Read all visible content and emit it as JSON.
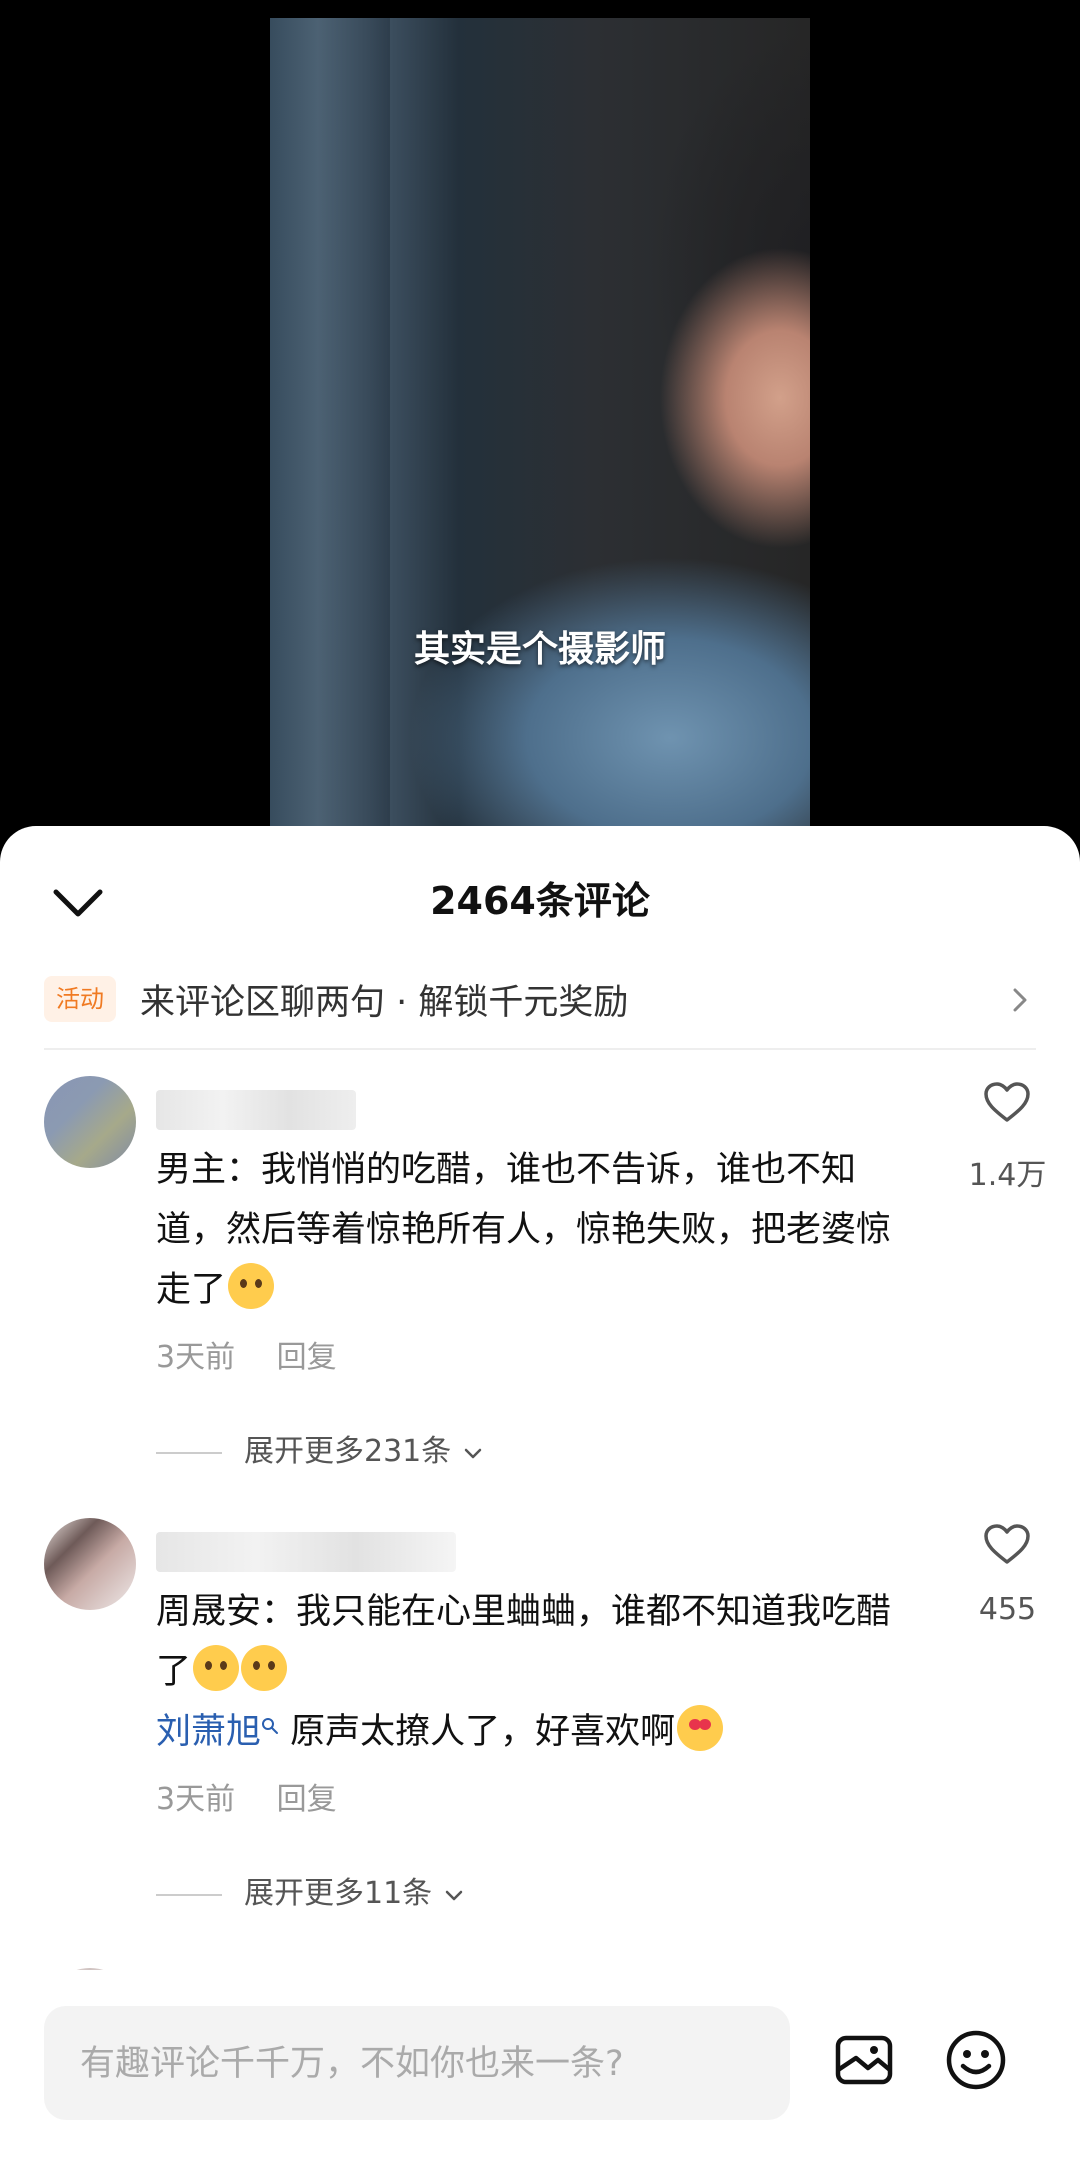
{
  "video": {
    "subtitle": "其实是个摄影师"
  },
  "comments_sheet": {
    "title": "2464条评论",
    "activity": {
      "badge": "活动",
      "text": "来评论区聊两句 · 解锁千元奖励"
    },
    "comments": [
      {
        "text": "男主：我悄悄的吃醋，谁也不告诉，谁也不知道，然后等着惊艳所有人，惊艳失败，把老婆惊走了",
        "time": "3天前",
        "reply_label": "回复",
        "like_count": "1.4万",
        "expand_label": "展开更多231条"
      },
      {
        "text": "周晟安：我只能在心里蛐蛐，谁都不知道我吃醋了",
        "mention": "刘萧旭",
        "mention_text": " 原声太撩人了，好喜欢啊",
        "time": "3天前",
        "reply_label": "回复",
        "like_count": "455",
        "expand_label": "展开更多11条"
      }
    ]
  },
  "input": {
    "placeholder": "有趣评论千千万，不如你也来一条?"
  },
  "icons": {
    "collapse": "chevron-down-icon",
    "activity_arrow": "chevron-right-icon",
    "like": "heart-icon",
    "image": "image-icon",
    "emoji": "smiley-icon"
  },
  "colors": {
    "activity_accent": "#f07a22",
    "mention": "#2a5fb0"
  }
}
